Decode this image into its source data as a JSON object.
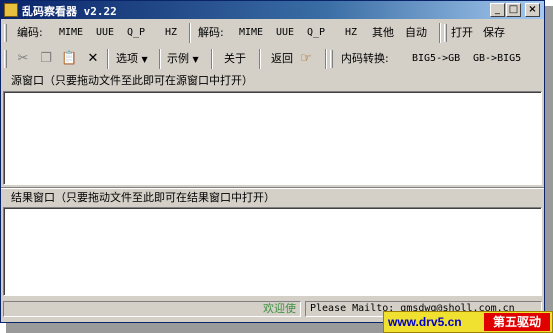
{
  "window": {
    "title": "乱码察看器 v2.22"
  },
  "title_buttons": {
    "minimize": "_",
    "maximize": "□",
    "close": "×"
  },
  "toolbar1": {
    "encode_label": "编码:",
    "encode": [
      "MIME",
      "UUE",
      "Q_P",
      "HZ"
    ],
    "decode_label": "解码:",
    "decode": [
      "MIME",
      "UUE",
      "Q_P",
      "HZ"
    ],
    "other": "其他",
    "auto": "自动",
    "open": "打开",
    "save": "保存"
  },
  "toolbar2": {
    "options": "选项",
    "examples": "示例",
    "about": "关于",
    "back": "返回",
    "convert_label": "内码转换:",
    "big5_to_gb": "BIG5->GB",
    "gb_to_big5": "GB->BIG5"
  },
  "source": {
    "label": "源窗口（只要拖动文件至此即可在源窗口中打开）",
    "value": ""
  },
  "result": {
    "label": "结果窗口（只要拖动文件至此即可在结果窗口中打开）",
    "value": ""
  },
  "status": {
    "welcome": "欢迎使",
    "mail": "Please Mailto: gmsdwq@sholl.com.cn"
  },
  "watermark": {
    "url": "www.drv5.cn",
    "brand": "第五驱动"
  },
  "icons": {
    "cut": "scissors-icon",
    "copy": "copy-icon",
    "paste": "paste-icon",
    "delete": "delete-x-icon",
    "back": "pointing-hand-icon"
  },
  "colors": {
    "titlebar_start": "#0a246a",
    "titlebar_end": "#a6caf0",
    "face": "#d4d0c8",
    "watermark_bg": "#f0e030",
    "watermark_brand_bg": "#e00000",
    "watermark_url": "#0000cc"
  }
}
